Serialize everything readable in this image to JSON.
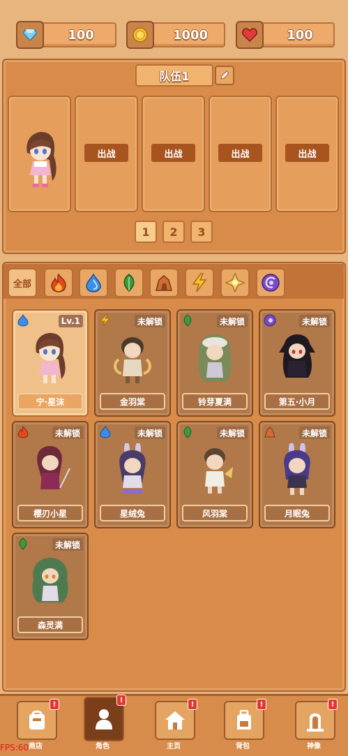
{
  "currency": {
    "gems": "100",
    "coins": "1000",
    "hearts": "100"
  },
  "team": {
    "title": "队伍1",
    "deploy_label": "出战",
    "pages": [
      "1",
      "2",
      "3"
    ]
  },
  "filters": {
    "all_label": "全部",
    "elements": [
      "fire-icon",
      "water-icon",
      "leaf-icon",
      "rock-icon",
      "lightning-icon",
      "light-icon",
      "void-icon"
    ]
  },
  "characters": [
    {
      "name": "宁·星沫",
      "badge": "Lv.1",
      "element": "water",
      "owned": true
    },
    {
      "name": "金羽棠",
      "badge": "未解锁",
      "element": "lightning",
      "owned": false
    },
    {
      "name": "铃芽夏满",
      "badge": "未解锁",
      "element": "leaf",
      "owned": false
    },
    {
      "name": "第五·小月",
      "badge": "未解锁",
      "element": "void",
      "owned": false
    },
    {
      "name": "樱刃小星",
      "badge": "未解锁",
      "element": "fire",
      "owned": false
    },
    {
      "name": "星绒兔",
      "badge": "未解锁",
      "element": "water",
      "owned": false
    },
    {
      "name": "风羽棠",
      "badge": "未解锁",
      "element": "leaf",
      "owned": false
    },
    {
      "name": "月眠兔",
      "badge": "未解锁",
      "element": "rock",
      "owned": false
    },
    {
      "name": "森灵满",
      "badge": "未解锁",
      "element": "leaf",
      "owned": false
    }
  ],
  "nav": {
    "items": [
      {
        "label": "商店"
      },
      {
        "label": "角色"
      },
      {
        "label": "主页"
      },
      {
        "label": "背包"
      },
      {
        "label": "神像"
      }
    ],
    "alert": "!"
  },
  "fps": "FPS:60",
  "colors": {
    "background": "#e9b57e",
    "panel": "#d98b49",
    "locked_card": "#b1784a",
    "owned_card": "#f0c08b",
    "deploy_button": "#a8541f",
    "alert": "#e03a2f"
  }
}
